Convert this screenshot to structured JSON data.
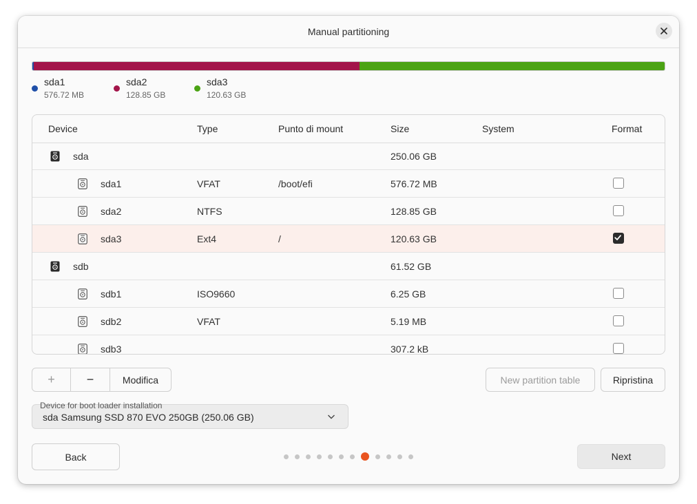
{
  "window": {
    "title": "Manual partitioning"
  },
  "partition_bar": [
    {
      "name": "sda1",
      "size": "576.72 MB",
      "color": "#1f4fa8",
      "fraction": 0.002
    },
    {
      "name": "sda2",
      "size": "128.85 GB",
      "color": "#a3154a",
      "fraction": 0.515
    },
    {
      "name": "sda3",
      "size": "120.63 GB",
      "color": "#4ba314",
      "fraction": 0.483
    }
  ],
  "table": {
    "headers": {
      "device": "Device",
      "type": "Type",
      "mount": "Punto di mount",
      "size": "Size",
      "system": "System",
      "format": "Format"
    },
    "rows": [
      {
        "device": "sda",
        "type": "",
        "mount": "",
        "size": "250.06 GB",
        "system": "",
        "format": null,
        "kind": "disk"
      },
      {
        "device": "sda1",
        "type": "VFAT",
        "mount": "/boot/efi",
        "size": "576.72 MB",
        "system": "",
        "format": false,
        "kind": "partition"
      },
      {
        "device": "sda2",
        "type": "NTFS",
        "mount": "",
        "size": "128.85 GB",
        "system": "",
        "format": false,
        "kind": "partition"
      },
      {
        "device": "sda3",
        "type": "Ext4",
        "mount": "/",
        "size": "120.63 GB",
        "system": "",
        "format": true,
        "kind": "partition",
        "selected": true
      },
      {
        "device": "sdb",
        "type": "",
        "mount": "",
        "size": "61.52 GB",
        "system": "",
        "format": null,
        "kind": "disk"
      },
      {
        "device": "sdb1",
        "type": "ISO9660",
        "mount": "",
        "size": "6.25 GB",
        "system": "",
        "format": false,
        "kind": "partition"
      },
      {
        "device": "sdb2",
        "type": "VFAT",
        "mount": "",
        "size": "5.19 MB",
        "system": "",
        "format": false,
        "kind": "partition"
      },
      {
        "device": "sdb3",
        "type": "",
        "mount": "",
        "size": "307.2 kB",
        "system": "",
        "format": false,
        "kind": "partition"
      }
    ]
  },
  "toolbar": {
    "add_icon": "+",
    "remove_icon": "−",
    "modify_label": "Modifica",
    "new_table_label": "New partition table",
    "reset_label": "Ripristina"
  },
  "bootloader": {
    "label": "Device for boot loader installation",
    "value": "sda Samsung SSD 870 EVO 250GB (250.06 GB)"
  },
  "footer": {
    "back_label": "Back",
    "next_label": "Next",
    "steps_total": 12,
    "current_step": 8
  },
  "colors": {
    "accent": "#e95420",
    "selected_row": "#fcefeb"
  }
}
